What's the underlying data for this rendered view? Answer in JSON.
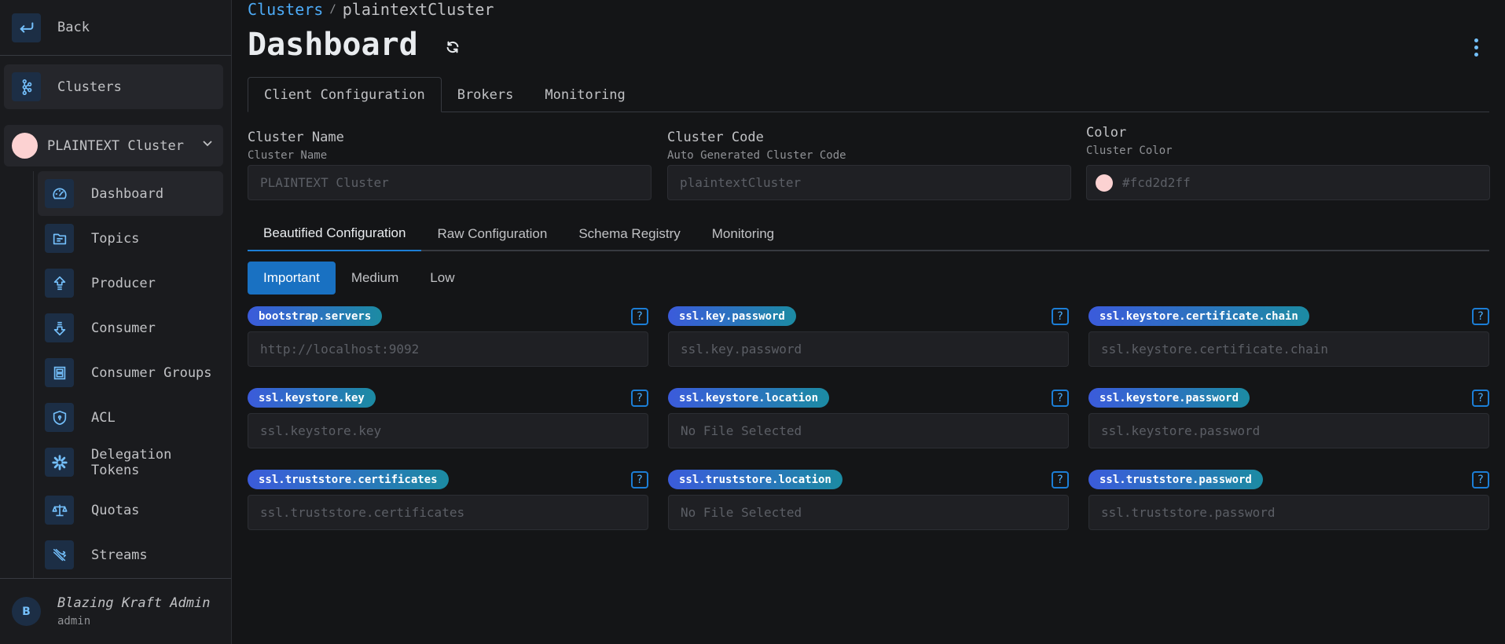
{
  "sidebar": {
    "back_label": "Back",
    "clusters_label": "Clusters",
    "selected_cluster": {
      "name": "PLAINTEXT Cluster",
      "color": "#fcd2d2"
    },
    "items": [
      {
        "label": "Dashboard",
        "icon": "gauge-icon",
        "active": true
      },
      {
        "label": "Topics",
        "icon": "folder-icon"
      },
      {
        "label": "Producer",
        "icon": "arrow-up-icon"
      },
      {
        "label": "Consumer",
        "icon": "arrow-down-icon"
      },
      {
        "label": "Consumer Groups",
        "icon": "server-group-icon"
      },
      {
        "label": "ACL",
        "icon": "shield-icon"
      },
      {
        "label": "Delegation Tokens",
        "icon": "asterisk-gear-icon"
      },
      {
        "label": "Quotas",
        "icon": "scale-icon"
      },
      {
        "label": "Streams",
        "icon": "streams-icon"
      }
    ],
    "user": {
      "initial": "B",
      "name": "Blazing Kraft Admin",
      "role": "admin"
    }
  },
  "header": {
    "breadcrumb": {
      "link": "Clusters",
      "separator": "/",
      "current": "plaintextCluster"
    },
    "title": "Dashboard"
  },
  "top_tabs": [
    {
      "label": "Client Configuration",
      "active": true
    },
    {
      "label": "Brokers"
    },
    {
      "label": "Monitoring"
    }
  ],
  "info": {
    "cluster_name": {
      "label": "Cluster Name",
      "description": "Cluster Name",
      "value": "PLAINTEXT Cluster"
    },
    "cluster_code": {
      "label": "Cluster Code",
      "description": "Auto Generated Cluster Code",
      "value": "plaintextCluster"
    },
    "color": {
      "label": "Color",
      "description": "Cluster Color",
      "value": "#fcd2d2ff"
    }
  },
  "config_tabs": [
    {
      "label": "Beautified Configuration",
      "active": true
    },
    {
      "label": "Raw Configuration"
    },
    {
      "label": "Schema Registry"
    },
    {
      "label": "Monitoring"
    }
  ],
  "priority_tabs": [
    {
      "label": "Important",
      "active": true
    },
    {
      "label": "Medium"
    },
    {
      "label": "Low"
    }
  ],
  "config_items": [
    {
      "key": "bootstrap.servers",
      "placeholder": "http://localhost:9092",
      "type": "text"
    },
    {
      "key": "ssl.key.password",
      "placeholder": "ssl.key.password",
      "type": "text"
    },
    {
      "key": "ssl.keystore.certificate.chain",
      "placeholder": "ssl.keystore.certificate.chain",
      "type": "text"
    },
    {
      "key": "ssl.keystore.key",
      "placeholder": "ssl.keystore.key",
      "type": "text"
    },
    {
      "key": "ssl.keystore.location",
      "placeholder": "No File Selected",
      "type": "file"
    },
    {
      "key": "ssl.keystore.password",
      "placeholder": "ssl.keystore.password",
      "type": "text"
    },
    {
      "key": "ssl.truststore.certificates",
      "placeholder": "ssl.truststore.certificates",
      "type": "text"
    },
    {
      "key": "ssl.truststore.location",
      "placeholder": "No File Selected",
      "type": "file"
    },
    {
      "key": "ssl.truststore.password",
      "placeholder": "ssl.truststore.password",
      "type": "text"
    }
  ],
  "help_glyph": "?",
  "colors": {
    "accent": "#1971c2",
    "link": "#4dabf7",
    "badge_start": "#3b5bdb",
    "badge_end": "#1c8ba3"
  }
}
